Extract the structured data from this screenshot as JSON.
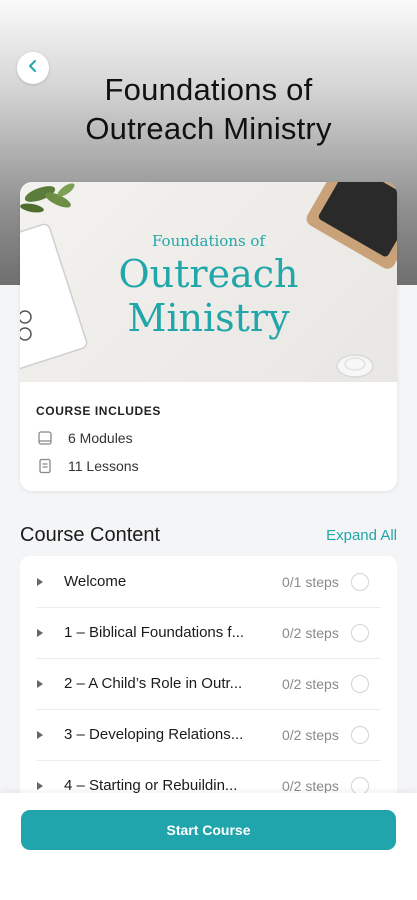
{
  "header": {
    "title_line1": "Foundations of",
    "title_line2": "Outreach Ministry",
    "back_icon": "chevron-left-icon"
  },
  "course_card": {
    "cover": {
      "subtitle": "Foundations of",
      "title_line1": "Outreach",
      "title_line2": "Ministry",
      "accent_color": "#21a6a9"
    },
    "includes_title": "COURSE INCLUDES",
    "includes": [
      {
        "icon": "module-icon",
        "label": "6 Modules"
      },
      {
        "icon": "document-icon",
        "label": "11 Lessons"
      }
    ]
  },
  "content": {
    "title": "Course Content",
    "expand_label": "Expand All",
    "lessons": [
      {
        "title": "Welcome",
        "steps": "0/1 steps"
      },
      {
        "title": "1 – Biblical Foundations f...",
        "steps": "0/2 steps"
      },
      {
        "title": "2 – A Child’s Role in Outr...",
        "steps": "0/2 steps"
      },
      {
        "title": "3 – Developing Relations...",
        "steps": "0/2 steps"
      },
      {
        "title": "4 – Starting or Rebuildin...",
        "steps": "0/2 steps"
      }
    ]
  },
  "footer": {
    "start_label": "Start Course",
    "button_color": "#1fa5ab"
  }
}
